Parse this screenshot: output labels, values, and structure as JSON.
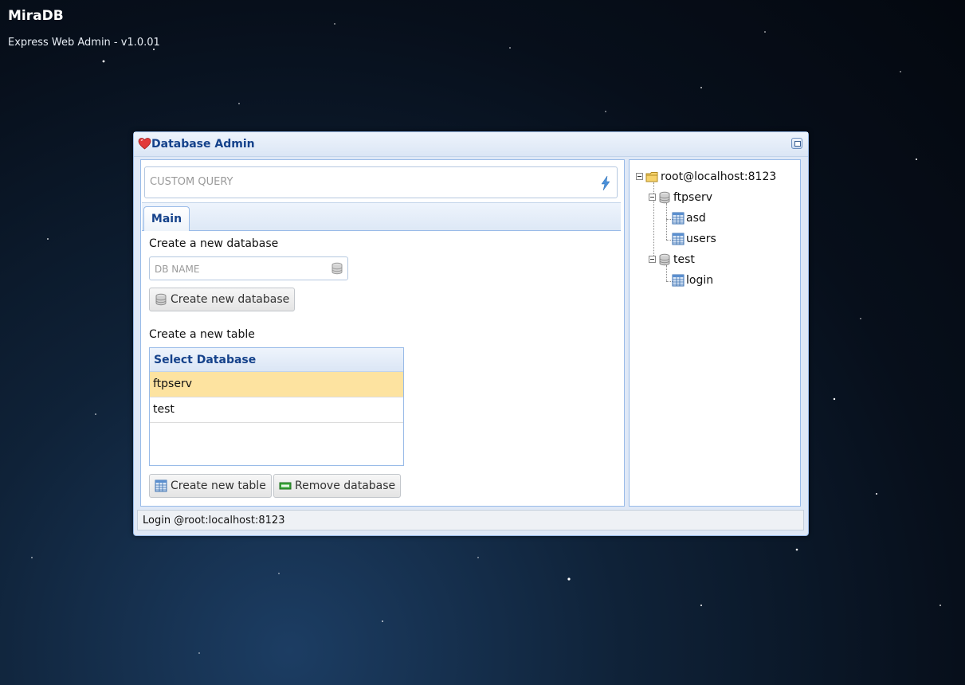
{
  "app": {
    "title": "MiraDB",
    "subtitle": "Express Web Admin - v1.0.01"
  },
  "window": {
    "title": "Database Admin",
    "query_placeholder": "CUSTOM QUERY",
    "tabs": [
      {
        "label": "Main",
        "active": true
      }
    ],
    "create_db": {
      "label": "Create a new database",
      "input_placeholder": "DB NAME",
      "button_label": "Create new database"
    },
    "create_table": {
      "label": "Create a new table",
      "grid_header": "Select Database",
      "rows": [
        {
          "name": "ftpserv",
          "selected": true
        },
        {
          "name": "test",
          "selected": false
        }
      ],
      "create_button_label": "Create new table",
      "remove_button_label": "Remove database"
    },
    "status": "Login @root:localhost:8123"
  },
  "tree": {
    "root": "root@localhost:8123",
    "databases": [
      {
        "name": "ftpserv",
        "tables": [
          "asd",
          "users"
        ]
      },
      {
        "name": "test",
        "tables": [
          "login"
        ]
      }
    ]
  },
  "colors": {
    "header_text": "#15428b",
    "border": "#99bbe8",
    "selected_row": "#fde3a0"
  }
}
